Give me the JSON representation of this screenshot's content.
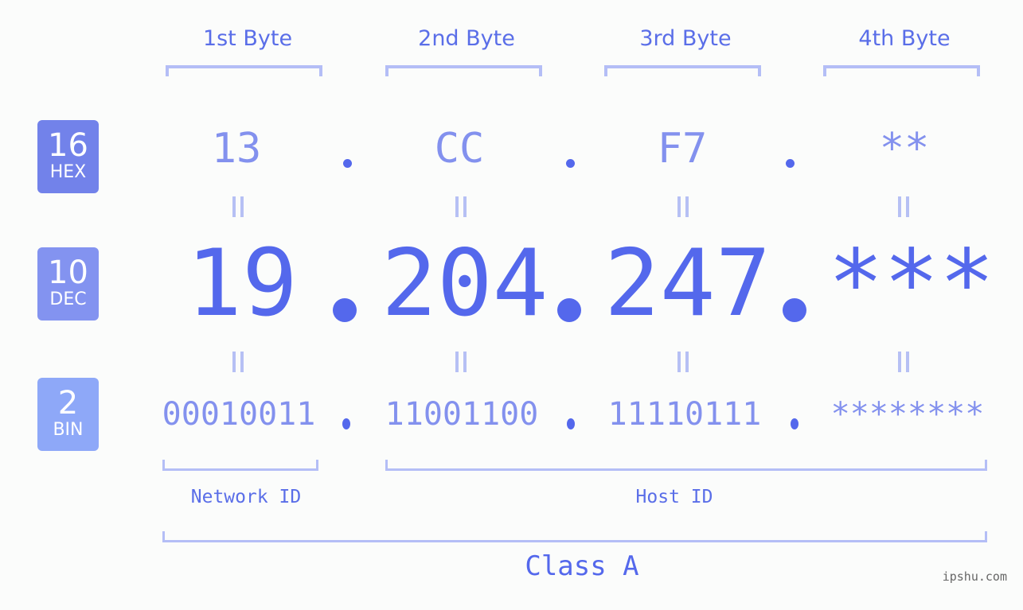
{
  "colors": {
    "hex_badge": "#7282ea",
    "dec_badge": "#8393f0",
    "bin_badge": "#8ea8f8",
    "accent": "#5468ec",
    "light_accent": "#8391ee",
    "bracket": "#b4bef6"
  },
  "badges": {
    "hex": {
      "num": "16",
      "label": "HEX"
    },
    "dec": {
      "num": "10",
      "label": "DEC"
    },
    "bin": {
      "num": "2",
      "label": "BIN"
    }
  },
  "bytes": [
    {
      "title": "1st Byte",
      "hex": "13",
      "dec": "19",
      "bin": "00010011"
    },
    {
      "title": "2nd Byte",
      "hex": "CC",
      "dec": "204",
      "bin": "11001100"
    },
    {
      "title": "3rd Byte",
      "hex": "F7",
      "dec": "247",
      "bin": "11110111"
    },
    {
      "title": "4th Byte",
      "hex": "**",
      "dec": "***",
      "bin": "********"
    }
  ],
  "labels": {
    "network_id": "Network ID",
    "host_id": "Host ID",
    "class": "Class A"
  },
  "brand": "ipshu.com"
}
